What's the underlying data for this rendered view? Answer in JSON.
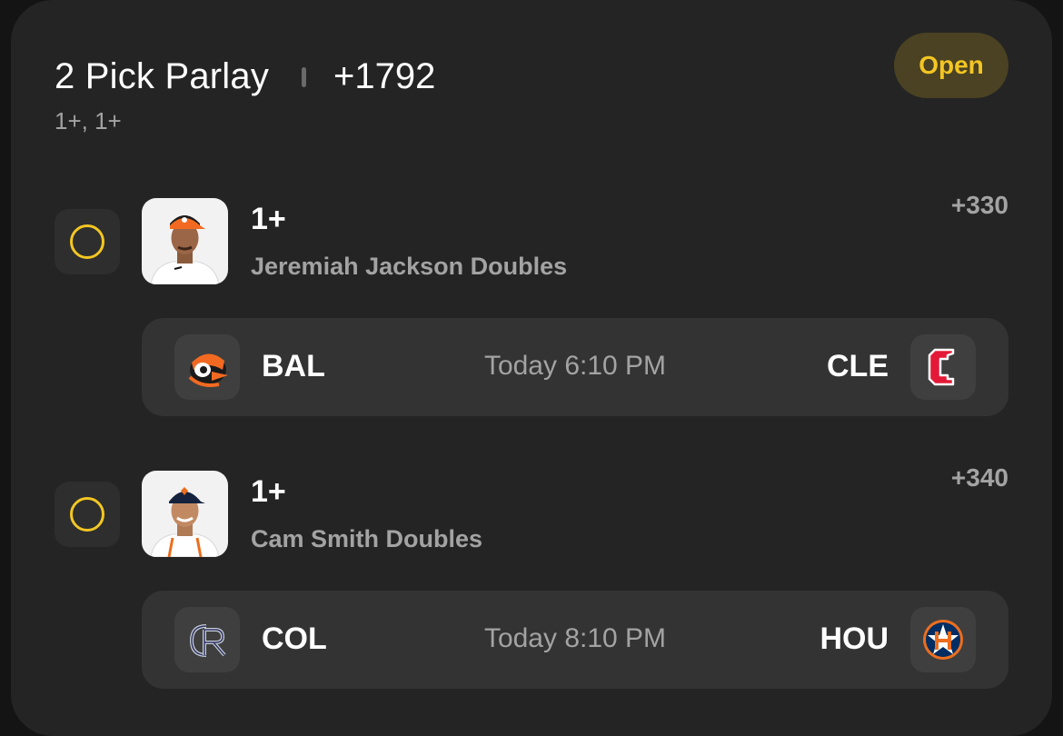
{
  "parlay": {
    "title": "2 Pick Parlay",
    "total_odds": "+1792",
    "subtitle": "1+, 1+",
    "status": "Open"
  },
  "legs": [
    {
      "line": "1+",
      "market": "Jeremiah Jackson Doubles",
      "odds": "+330",
      "avatar": "player-headshot-orioles",
      "game": {
        "away": "BAL",
        "home": "CLE",
        "time": "Today 6:10 PM",
        "away_logo": "orioles-bird-icon",
        "home_logo": "guardians-c-icon"
      }
    },
    {
      "line": "1+",
      "market": "Cam Smith Doubles",
      "odds": "+340",
      "avatar": "player-headshot-astros",
      "game": {
        "away": "COL",
        "home": "HOU",
        "time": "Today 8:10 PM",
        "away_logo": "rockies-cr-icon",
        "home_logo": "astros-h-star-icon"
      }
    }
  ],
  "colors": {
    "accent": "#f3c623",
    "card": "#242424",
    "panel": "#333333"
  }
}
